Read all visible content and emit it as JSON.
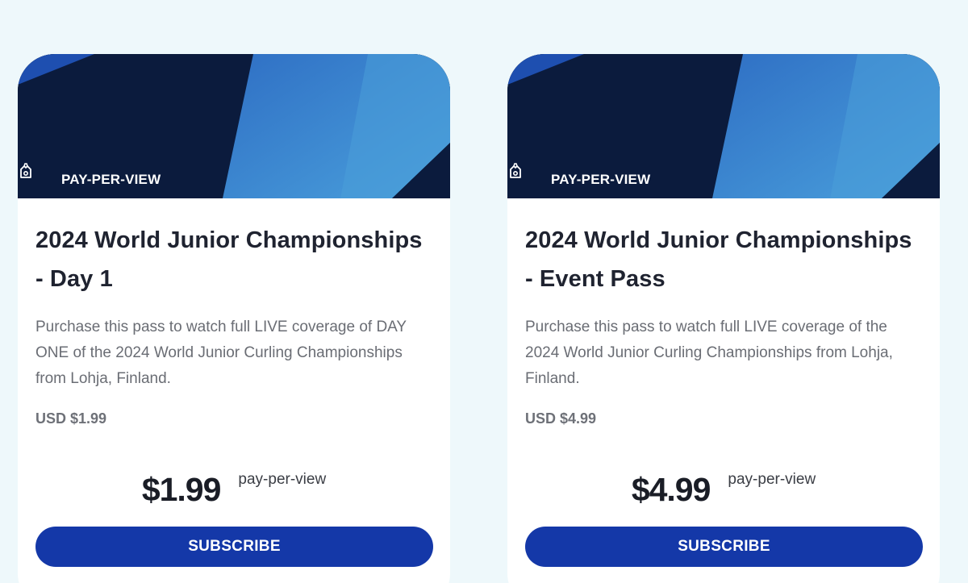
{
  "cards": [
    {
      "badge": "PAY-PER-VIEW",
      "badge_icon": "ticket-icon",
      "title_line1": "2024 World Junior Championships",
      "title_line2": "- Day 1",
      "description": "Purchase this pass to watch full LIVE coverage of DAY ONE of the 2024 World Junior Curling Championships from Lohja, Finland.",
      "usd_price": "USD $1.99",
      "price": "$1.99",
      "period": "pay-per-view",
      "button": "SUBSCRIBE"
    },
    {
      "badge": "PAY-PER-VIEW",
      "badge_icon": "ticket-icon",
      "title_line1": "2024 World Junior Championships",
      "title_line2": "- Event Pass",
      "description": "Purchase this pass to watch full LIVE coverage of the 2024 World Junior Curling Championships from Lohja, Finland.",
      "usd_price": "USD $4.99",
      "price": "$4.99",
      "period": "pay-per-view",
      "button": "SUBSCRIBE"
    }
  ],
  "colors": {
    "page_background": "#eef8fb",
    "banner_dark": "#0b1b3d",
    "banner_blue": "#3b8fd6",
    "button": "#1438a8"
  }
}
